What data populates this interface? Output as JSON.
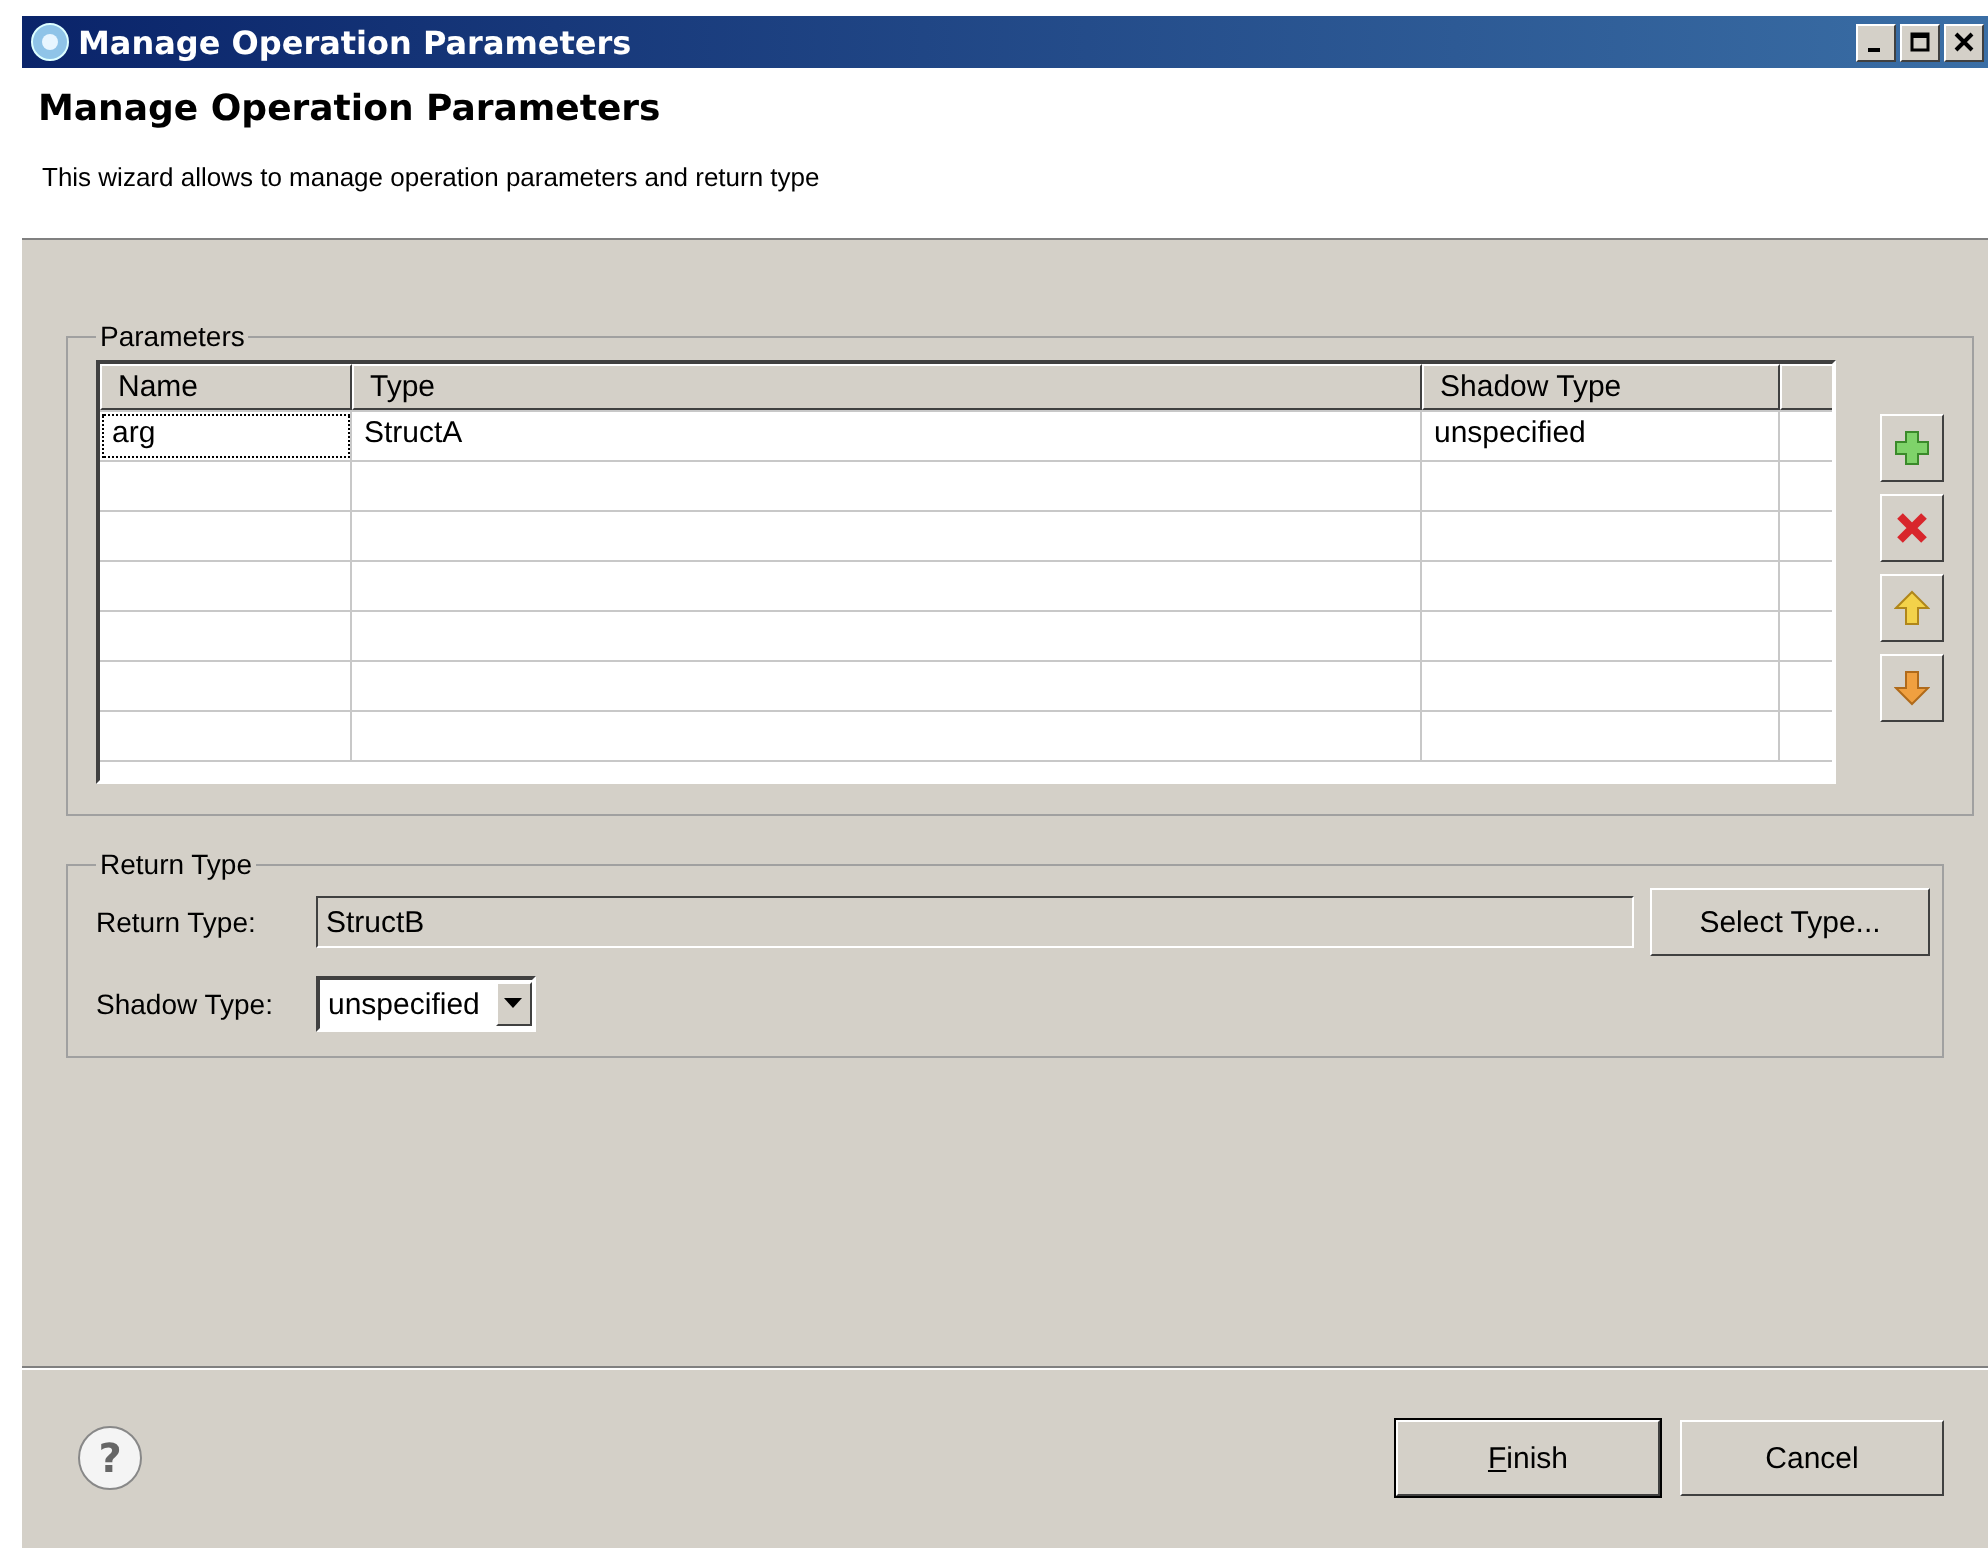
{
  "window": {
    "title": "Manage Operation Parameters"
  },
  "header": {
    "title": "Manage Operation Parameters",
    "description": "This wizard allows to manage operation parameters and return type"
  },
  "parameters": {
    "group_label": "Parameters",
    "columns": [
      "Name",
      "Type",
      "Shadow Type"
    ],
    "rows": [
      {
        "name": "arg",
        "type": "StructA",
        "shadow_type": "unspecified",
        "selected": true
      }
    ]
  },
  "return_type": {
    "group_label": "Return Type",
    "return_label": "Return Type:",
    "return_value": "StructB",
    "select_button": "Select Type...",
    "shadow_label": "Shadow Type:",
    "shadow_value": "unspecified"
  },
  "help": {
    "symbol": "?"
  },
  "buttons": [
    {
      "label": "Finish",
      "default": true
    },
    {
      "label": "Cancel",
      "default": false
    }
  ]
}
